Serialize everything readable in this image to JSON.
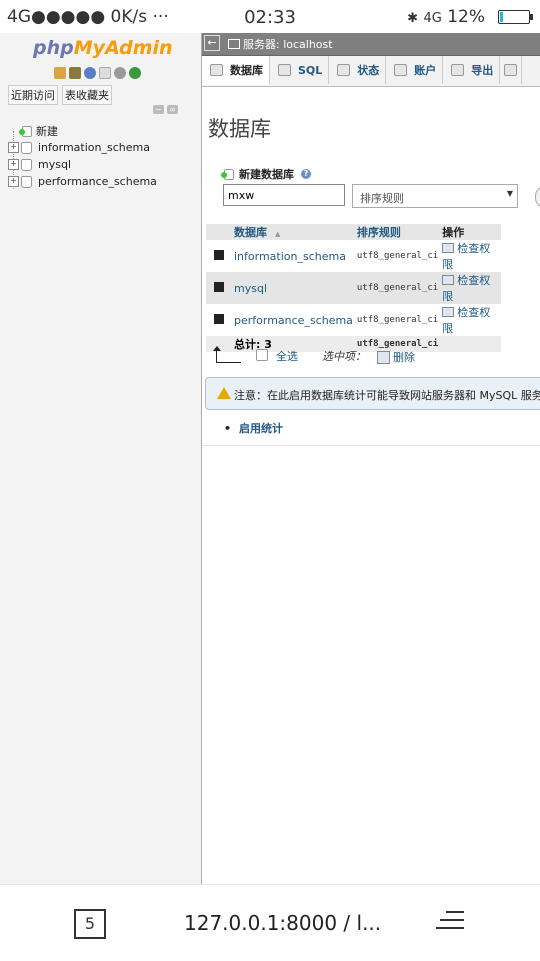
{
  "status_bar": {
    "network": "4G●●●●● 0K/s ···",
    "time": "02:33",
    "signal": "4G",
    "battery_percent": "12%",
    "battery_level": 0.12
  },
  "nav": {
    "logo_php": "php",
    "logo_myadmin": "MyAdmin",
    "recent_link": "近期访问",
    "favorites_link": "表收藏夹",
    "new_item": "新建",
    "databases": [
      "information_schema",
      "mysql",
      "performance_schema"
    ]
  },
  "server_bar": {
    "back": "←",
    "label": "服务器: localhost"
  },
  "tabs": [
    {
      "label": "数据库",
      "icon": "database-icon",
      "active": true
    },
    {
      "label": "SQL",
      "icon": "sql-icon",
      "active": false
    },
    {
      "label": "状态",
      "icon": "status-icon",
      "active": false
    },
    {
      "label": "账户",
      "icon": "accounts-icon",
      "active": false
    },
    {
      "label": "导出",
      "icon": "export-icon",
      "active": false
    }
  ],
  "page": {
    "title": "数据库",
    "create_label": "新建数据库",
    "db_name_value": "mxw",
    "collation_placeholder": "排序规则"
  },
  "table": {
    "headers": {
      "database": "数据库",
      "collation": "排序规则",
      "action": "操作"
    },
    "rows": [
      {
        "name": "information_schema",
        "collation": "utf8_general_ci",
        "action": "检查权限"
      },
      {
        "name": "mysql",
        "collation": "utf8_general_ci",
        "action": "检查权限"
      },
      {
        "name": "performance_schema",
        "collation": "utf8_general_ci",
        "action": "检查权限"
      }
    ],
    "total_label": "总计: 3",
    "total_collation": "utf8_general_ci"
  },
  "bulk": {
    "check_all": "全选",
    "with_selected": "选中项：",
    "delete": "删除"
  },
  "notice": {
    "text": "注意：在此启用数据库统计可能导致网站服务器和 MySQL 服务器"
  },
  "enable_stats": "启用统计",
  "browser": {
    "tab_count": "5",
    "url": "127.0.0.1:8000 / l..."
  },
  "colors": {
    "link": "#235a81",
    "logo_php": "#6c78af",
    "logo_myadmin": "#f89c0e",
    "battery": "#27b8d4"
  }
}
